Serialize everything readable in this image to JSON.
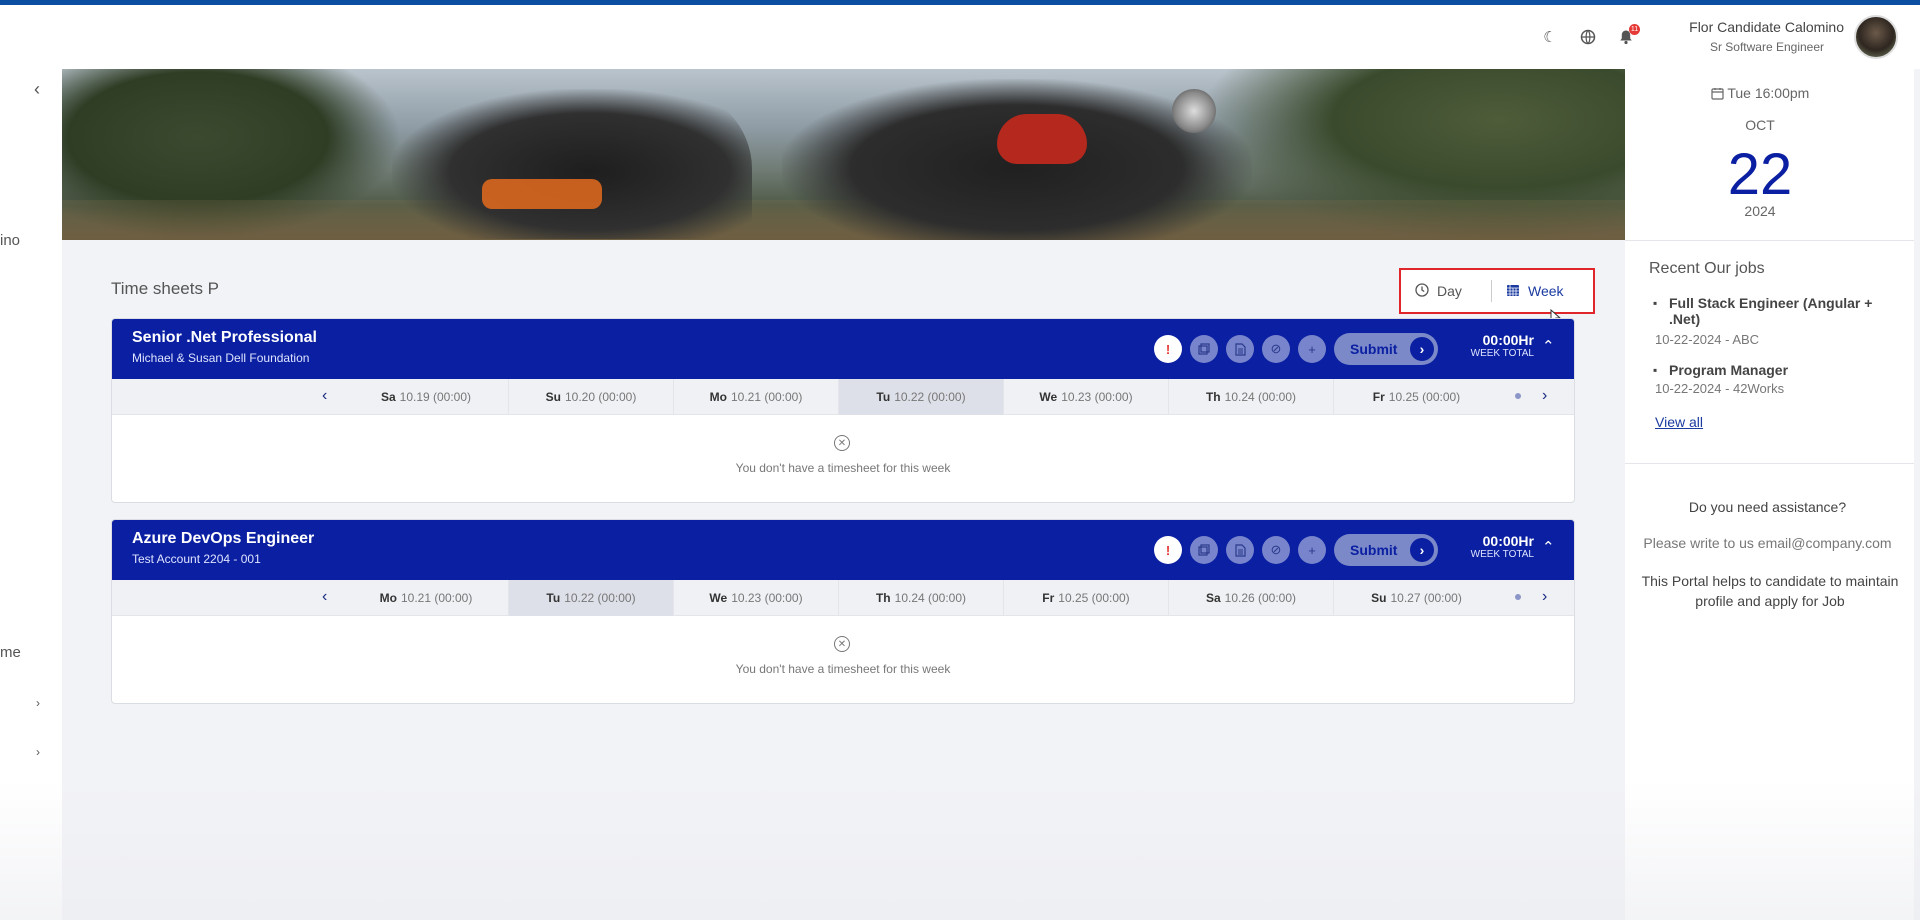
{
  "header": {
    "icons": {
      "theme": "moon-icon",
      "language": "globe-icon",
      "notifications": "bell-icon"
    },
    "notification_count": "11",
    "user_name": "Flor Candidate Calomino",
    "user_role": "Sr Software Engineer"
  },
  "sidebar": {
    "fragment_1": "ino",
    "fragment_2": "me"
  },
  "main": {
    "title": "Time sheets P",
    "view_toggle": {
      "day_label": "Day",
      "week_label": "Week"
    },
    "timesheets": [
      {
        "title": "Senior .Net Professional",
        "subtitle": "Michael & Susan Dell Foundation",
        "submit_label": "Submit",
        "total_value": "00:00Hr",
        "total_label": "WEEK TOTAL",
        "days": [
          {
            "abbr": "Sa",
            "date": "10.19 (00:00)"
          },
          {
            "abbr": "Su",
            "date": "10.20 (00:00)"
          },
          {
            "abbr": "Mo",
            "date": "10.21 (00:00)"
          },
          {
            "abbr": "Tu",
            "date": "10.22 (00:00)"
          },
          {
            "abbr": "We",
            "date": "10.23 (00:00)"
          },
          {
            "abbr": "Th",
            "date": "10.24 (00:00)"
          },
          {
            "abbr": "Fr",
            "date": "10.25 (00:00)"
          }
        ],
        "current_day_index": 3,
        "empty_text": "You don't have a timesheet for this week"
      },
      {
        "title": "Azure DevOps Engineer",
        "subtitle": "Test Account 2204 - 001",
        "submit_label": "Submit",
        "total_value": "00:00Hr",
        "total_label": "WEEK TOTAL",
        "days": [
          {
            "abbr": "Mo",
            "date": "10.21 (00:00)"
          },
          {
            "abbr": "Tu",
            "date": "10.22 (00:00)"
          },
          {
            "abbr": "We",
            "date": "10.23 (00:00)"
          },
          {
            "abbr": "Th",
            "date": "10.24 (00:00)"
          },
          {
            "abbr": "Fr",
            "date": "10.25 (00:00)"
          },
          {
            "abbr": "Sa",
            "date": "10.26 (00:00)"
          },
          {
            "abbr": "Su",
            "date": "10.27 (00:00)"
          }
        ],
        "current_day_index": 1,
        "empty_text": "You don't have a timesheet for this week"
      }
    ]
  },
  "right_panel": {
    "datetime": "Tue 16:00pm",
    "month": "OCT",
    "day": "22",
    "year": "2024",
    "jobs_title": "Recent Our jobs",
    "jobs": [
      {
        "title": "Full Stack Engineer (Angular + .Net)",
        "meta": "10-22-2024 - ABC"
      },
      {
        "title": "Program Manager",
        "meta": "10-22-2024 - 42Works"
      }
    ],
    "view_all": "View all",
    "assist_title": "Do you need assistance?",
    "assist_email": "Please write to us email@company.com",
    "assist_text": "This Portal helps to candidate to maintain profile and apply for Job"
  },
  "colors": {
    "brand": "#0a1fa1",
    "topbar": "#0c4ea0",
    "highlight": "#e0262b",
    "alert": "#e53935"
  }
}
